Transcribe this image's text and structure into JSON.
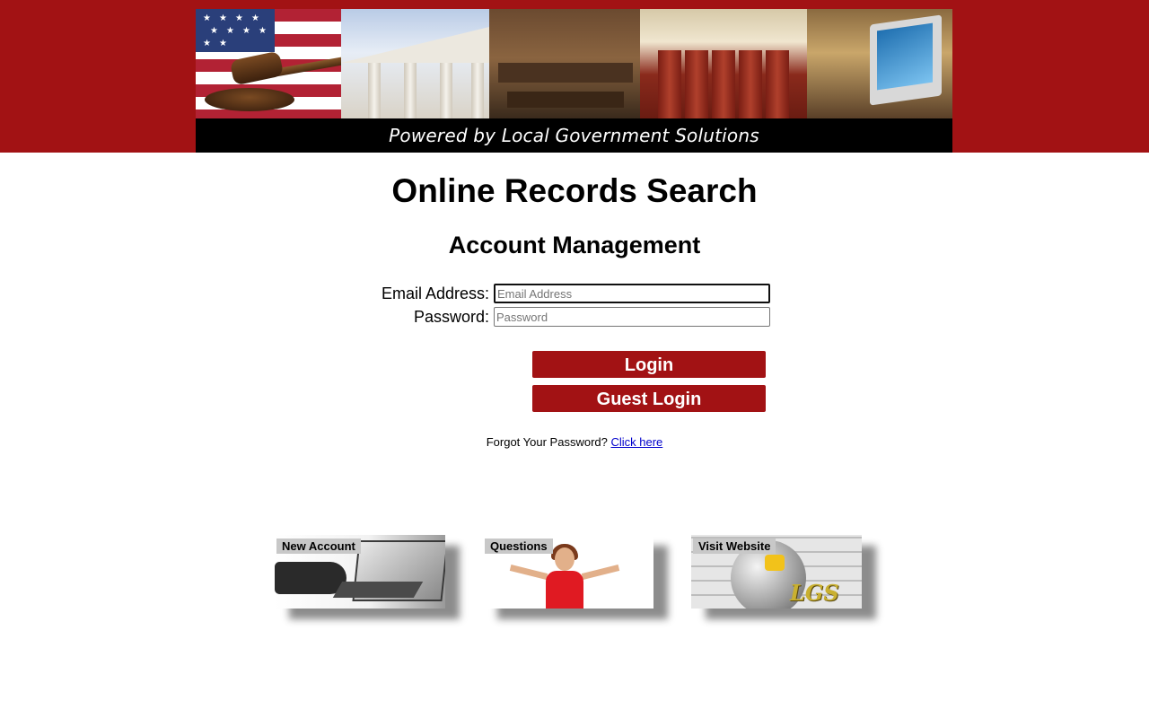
{
  "header": {
    "tagline": "Powered by Local Government Solutions",
    "background_color": "#a21214",
    "banner_panels": [
      "flag-gavel-image",
      "courthouse-image",
      "courtroom-image",
      "law-books-image",
      "computers-image"
    ]
  },
  "main": {
    "title": "Online Records Search",
    "subtitle": "Account Management"
  },
  "form": {
    "email_label": "Email Address:",
    "email_placeholder": "Email Address",
    "email_value": "",
    "password_label": "Password:",
    "password_placeholder": "Password",
    "password_value": "",
    "login_label": "Login",
    "guest_login_label": "Guest Login",
    "button_color": "#a21214"
  },
  "forgot": {
    "prompt": "Forgot Your Password?",
    "link_label": "Click here",
    "link_color": "#0000cc"
  },
  "tiles": [
    {
      "label": "New Account",
      "icon": "laptop-typing-image"
    },
    {
      "label": "Questions",
      "icon": "shrugging-woman-image"
    },
    {
      "label": "Visit Website",
      "icon": "lgs-globe-image",
      "logo_text": "LGS"
    }
  ]
}
